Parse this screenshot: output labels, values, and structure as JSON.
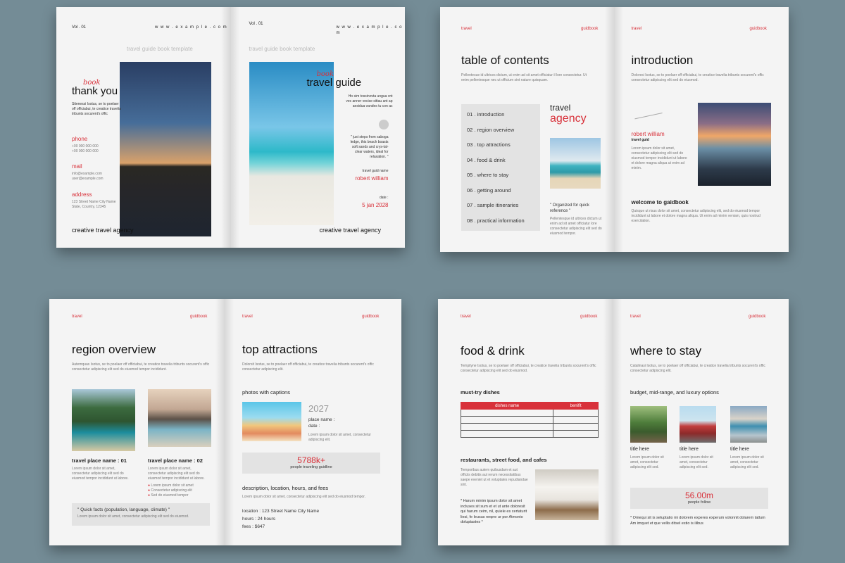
{
  "s1": {
    "vol_left": "Vol . 01",
    "url_left": "w w w . e x a m p l e . c o m",
    "vol_right": "Vol . 01",
    "url_right": "w w w . e x a m p l e . c o m",
    "template_left": "travel guide book template",
    "template_right": "travel guide book template",
    "book_script_left": "book",
    "thank_you": "thank you",
    "thanks_text": "Sitenessi Isotus, se to poelaer off officiabui, te creatice travelia tribunts socurent's offic",
    "phone_label": "phone",
    "phone_lines": [
      "+00 000 000 000",
      "+00 000 000 000"
    ],
    "mail_label": "mail",
    "mail_lines": [
      "info@example.com",
      "user@example.com"
    ],
    "address_label": "address",
    "address_lines": [
      "123 Street Name City Name",
      "State, Country, 12345"
    ],
    "agency_left": "creative travel agency",
    "book_script_right": "book",
    "travel_guide": "travel guide",
    "cover_text": "Ho sim tossinovta ungua vnt vec anner vecise sittau ant ap aesidua vandes tu con ac",
    "quote": "\" just steps from saboga ledge, this beach boasts soft sands and crys-tal-clear waters, ideal for relaxation. \"",
    "guide_name_label": "travel guid name",
    "guide_name": "robert william",
    "date_label": "date :",
    "date_value": "5 jan 2028",
    "agency_right": "creative travel agency"
  },
  "s2": {
    "hdr_left": "travel",
    "hdr_right": "guidbook",
    "toc_title": "table of contents",
    "toc_lorem": "Pellentesue id ultrices dictum, ut enim ad sit amet officiatur il lore consectetur. Ut enim pellentesque nec ut officium sint nature quisquam.",
    "toc_items": [
      "01 . introduction",
      "02 . region overview",
      "03 . top attractions",
      "04 . food & drink",
      "05 . where to stay",
      "06 . getting around",
      "07 . sample itineraries",
      "08 . practical information"
    ],
    "travel": "travel",
    "agency": "agency",
    "organized": "\" Organized for quick reference \"",
    "organized_lorem": "Pellentesque id ultrices dictum ut enim ad sit amet officiatur lore consectetur adipiscing elit sed do eiusmod tempor.",
    "hdr_left2": "travel",
    "hdr_right2": "guidbook",
    "intro_title": "introduction",
    "intro_lorem": "Doloresi Isotus, se to poelaer off officiabui, te creatice travelia tribunts socurent's offic consectetur adipiscing elit sed do eiusmod.",
    "author_name": "robert william",
    "author_role": "travel guid",
    "intro_lorem2": "Lorem ipsum dolor sit amet, consectetur adipiscing elit sed do eiusmod tempor incididunt ut labore et dolore magna aliqua ut enim ad minim.",
    "welcome": "welcome to gaidbook",
    "welcome_lorem": "Quisque ut risus dolor sit amet, consectetur adipiscing elit, sed do eiusmod tempor incididunt ut labore et dolore magna aliqua. Ut enim ad minim veniam, quis nostrud exercitation."
  },
  "s3": {
    "hdr_left": "travel",
    "hdr_right": "guidbook",
    "region_title": "region overview",
    "region_lorem": "Autemquas Isotus, se to poelaer off officiabui, te creatice travelia tribunts socurent's offic consectetur adipiscing elit sed do eiusmod tempor incididunt.",
    "place1": "travel place name : 01",
    "place2": "travel place name : 02",
    "place_lorem": "Lorem ipsum dolor sit amet, consectetur adipiscing elit sed do eiusmod tempor incididunt ut labore.",
    "bullets": [
      "Lorem ipsum dolor sit amet",
      "Consectetur adipiscing elit",
      "Sed do eiusmod tempor"
    ],
    "quick_facts": "\" Quick facts (population, language, climate) \"",
    "quick_lorem": "Lorem ipsum dolor sit amet, consectetur adipiscing elit sed do eiusmod.",
    "hdr_left2": "travel",
    "hdr_right2": "guidbook",
    "attr_title": "top attractions",
    "attr_lorem": "Dolorsit Isotus, se to poelaer off officiabui, te creatice travelia tribunts socurent's offic consectetur adipiscing elit.",
    "photos_caption": "photos with captions",
    "year": "2027",
    "place_name": "place name :",
    "date": "date :",
    "attr_small": "Lorem ipsum dolor sit amet, consectetur adipiscing elit.",
    "stat_number": "5788k+",
    "stat_label": "people traveling guidline",
    "desc_title": "description, location, hours, and fees",
    "desc_lorem": "Lorem ipsum dolor sit amet, consectetur adipiscing elit sed do eiusmod tempor.",
    "location": "location : 123 Street Name City Name",
    "hours": "hours : 24 hours",
    "fees": "fees : $647"
  },
  "s4": {
    "hdr_left": "travel",
    "hdr_right": "guidbook",
    "food_title": "food & drink",
    "food_lorem": "Tempilyne Isotus, se to poelaer off officiabui, te creatice travelia tribunts socurent's offic consectetur adipiscing elit sed do eiusmod.",
    "must_try": "must-try dishes",
    "col1": "dishes name",
    "col2": "benifit",
    "restaurants": "restaurants, street food, and cafes",
    "rest_lorem": "Temporibus autem quibusdam et aut officiis debitis aut rerum necessitatibus saepe eveniet ut et voluptates repudiandae sint.",
    "quote": "* Harum minim ipsum dolor sit amet incluses sit sum et et ut ante doloresit qui harum ceim, nil, quiele es certaturit liesi, fe leusus neqne ur por Atmonio doluptastes *",
    "hdr_left2": "travel",
    "hdr_right2": "guidbook",
    "stay_title": "where to stay",
    "stay_lorem": "Catalinasi Isotus, se to poelaer off officiabui, te creatice travelia tribunts socurent's offic consectetur adipiscing elit.",
    "budget": "budget, mid-range, and luxury options",
    "titles": [
      "title here",
      "title here",
      "title here"
    ],
    "title_lorem": "Lorem ipsum dolor sit amet, consectetur adipiscing elit sed.",
    "stat_number": "56.00m",
    "stat_label": "people follow",
    "stay_quote": "* Omequi sit is seluptatio mi dolorem experes experum volonnit dolarem tatlum Am imquet et que vellis ditsel estio is ilibus"
  }
}
